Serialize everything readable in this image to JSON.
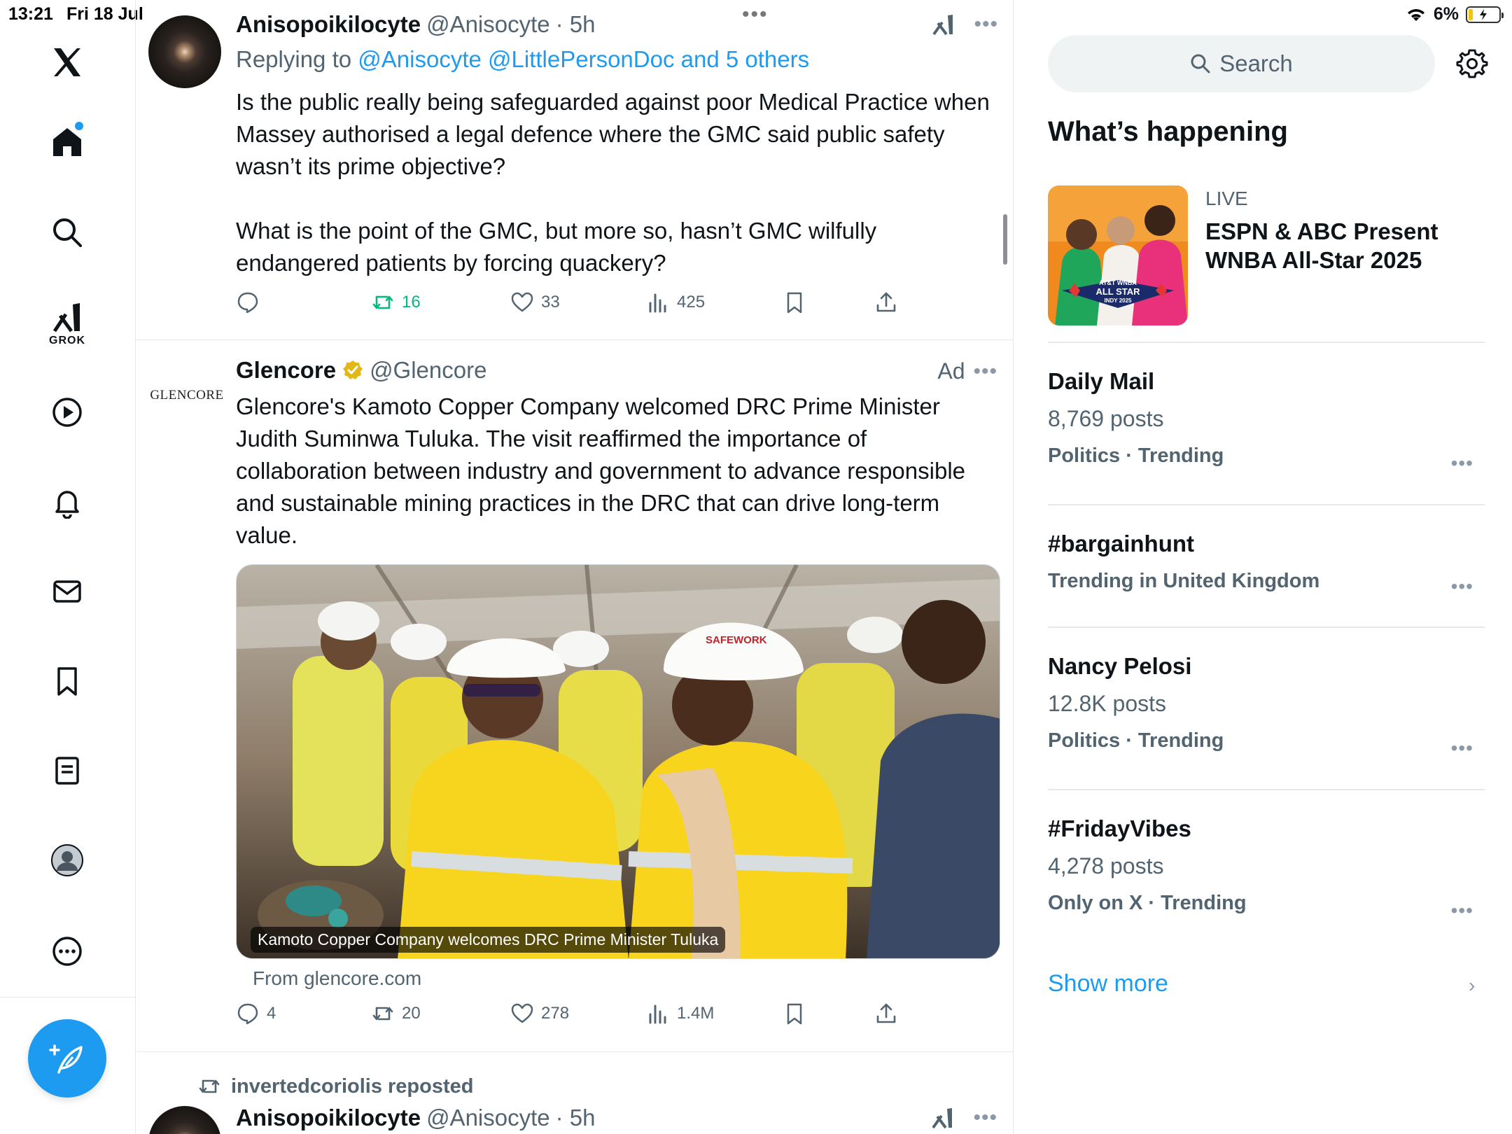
{
  "status": {
    "time": "13:21",
    "date": "Fri 18 Jul",
    "battery": "6%",
    "top_dots": "•••"
  },
  "sidebar": {
    "items": [
      {
        "name": "x-logo"
      },
      {
        "name": "home"
      },
      {
        "name": "explore"
      },
      {
        "name": "grok"
      },
      {
        "name": "video"
      },
      {
        "name": "notifications"
      },
      {
        "name": "messages"
      },
      {
        "name": "bookmarks"
      },
      {
        "name": "lists"
      },
      {
        "name": "profile"
      },
      {
        "name": "more"
      }
    ],
    "grok_label": "GROK"
  },
  "tweets": [
    {
      "name": "Anisopoikilocyte",
      "handle": "@Anisocyte",
      "time": "· 5h",
      "replying_prefix": "Replying to",
      "replying_to": "@Anisocyte @LittlePersonDoc and 5 others",
      "text": "Is the public really being safeguarded against poor Medical Practice when Massey authorised a legal defence where the GMC said public safety wasn’t its prime objective?\n\nWhat is the point of the GMC, but more so, hasn’t GMC wilfully endangered patients by forcing quackery?",
      "replies": "",
      "retweets": "16",
      "likes": "33",
      "views": "425"
    },
    {
      "name": "Glencore",
      "handle": "@Glencore",
      "ad_label": "Ad",
      "logo_text": "GLENCORE",
      "text": "Glencore's Kamoto Copper Company welcomed DRC Prime Minister Judith Suminwa Tuluka. The visit reaffirmed the importance of collaboration between industry and government to advance responsible and sustainable mining practices in the DRC that can drive long-term value.",
      "media_caption": "Kamoto Copper Company welcomes DRC Prime Minister Tuluka",
      "helmet_text": "SAFEWORK",
      "from": "From glencore.com",
      "replies": "4",
      "retweets": "20",
      "likes": "278",
      "views": "1.4M"
    },
    {
      "repost_by": "invertedcoriolis reposted",
      "name": "Anisopoikilocyte",
      "handle": "@Anisocyte",
      "time": "· 5h"
    }
  ],
  "right": {
    "search_placeholder": "Search",
    "whats_happening": "What’s happening",
    "live": {
      "label": "LIVE",
      "title": "ESPN & ABC Present WNBA All-Star 2025",
      "thumb_text": [
        "AT&T WNBA",
        "ALL STAR",
        "INDY 2025"
      ]
    },
    "trends": [
      {
        "title": "Daily Mail",
        "posts": "8,769 posts",
        "meta": "Politics · Trending"
      },
      {
        "title": "#bargainhunt",
        "posts": "",
        "meta": "Trending in United Kingdom"
      },
      {
        "title": "Nancy Pelosi",
        "posts": "12.8K posts",
        "meta": "Politics · Trending"
      },
      {
        "title": "#FridayVibes",
        "posts": "4,278 posts",
        "meta": "Only on X · Trending"
      }
    ],
    "show_more": "Show more"
  },
  "colors": {
    "accent": "#1d9bf0",
    "retweet_green": "#00ba7c",
    "text_secondary": "#536471"
  }
}
